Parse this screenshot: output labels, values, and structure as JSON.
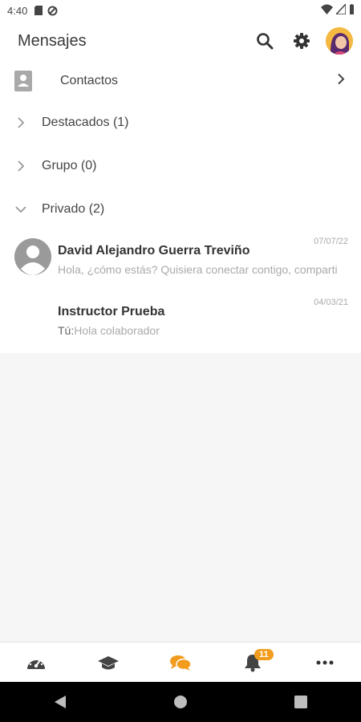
{
  "status_bar": {
    "time": "4:40"
  },
  "app_bar": {
    "title": "Mensajes"
  },
  "contacts_row": {
    "label": "Contactos"
  },
  "sections": [
    {
      "label": "Destacados (1)",
      "expanded": false
    },
    {
      "label": "Grupo (0)",
      "expanded": false
    },
    {
      "label": "Privado (2)",
      "expanded": true
    }
  ],
  "conversations": [
    {
      "name": "David Alejandro Guerra Treviño",
      "preview": "Hola, ¿cómo estás? Quisiera conectar contigo, comparti",
      "date": "07/07/22"
    },
    {
      "name": "Instructor Prueba",
      "sender_prefix": "Tú:",
      "preview": "Hola colaborador",
      "date": "04/03/21"
    }
  ],
  "bottom_nav": {
    "items": [
      "dashboard-icon",
      "courses-icon",
      "messages-icon",
      "notifications-icon",
      "more-icon"
    ],
    "notifications_badge": "11",
    "active_color": "#f29b1d"
  }
}
